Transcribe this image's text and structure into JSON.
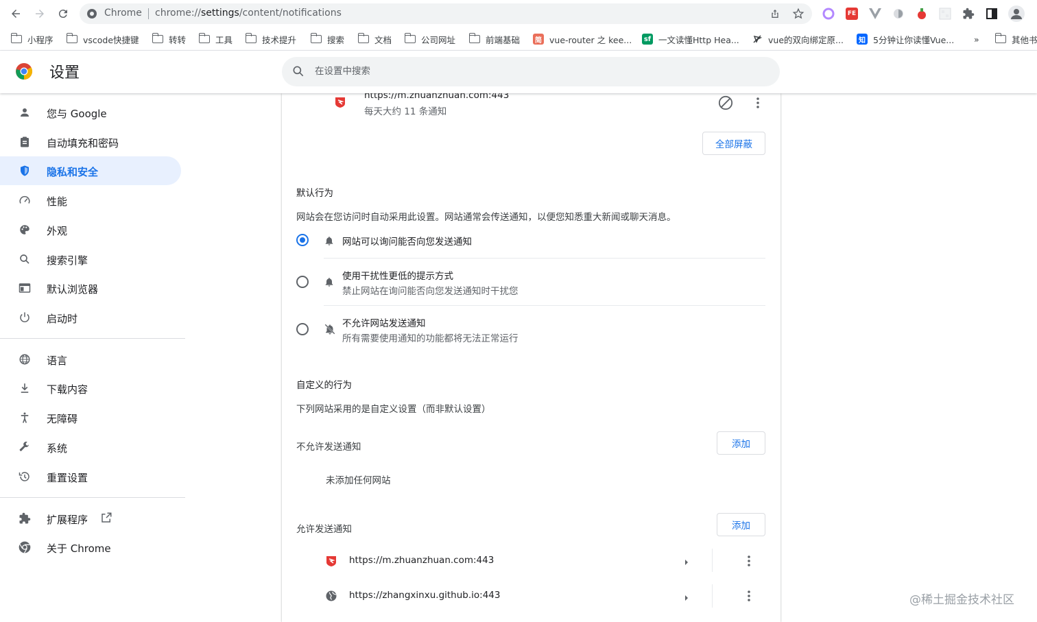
{
  "browser": {
    "omnibox_prefix": "Chrome",
    "url_scheme": "chrome://",
    "url_host": "settings",
    "url_path": "/content/notifications"
  },
  "bookmarks": [
    {
      "label": "小程序",
      "icon": "folder-icon"
    },
    {
      "label": "vscode快捷键",
      "icon": "folder-icon"
    },
    {
      "label": "转转",
      "icon": "folder-icon"
    },
    {
      "label": "工具",
      "icon": "folder-icon"
    },
    {
      "label": "技术提升",
      "icon": "folder-icon"
    },
    {
      "label": "搜索",
      "icon": "folder-icon"
    },
    {
      "label": "文档",
      "icon": "folder-icon"
    },
    {
      "label": "公司网址",
      "icon": "folder-icon"
    },
    {
      "label": "前端基础",
      "icon": "folder-icon"
    },
    {
      "label": "vue-router 之 kee...",
      "icon": "jianshu-icon",
      "badge": "简"
    },
    {
      "label": "一文读懂Http Hea...",
      "icon": "segmentfault-icon",
      "badge": "sf"
    },
    {
      "label": "vue的双向绑定原...",
      "icon": "link-icon"
    },
    {
      "label": "5分钟让你读懂Vue...",
      "icon": "zhihu-icon",
      "badge": "知"
    },
    {
      "label": "»",
      "icon": "more-icon"
    },
    {
      "label": "其他书签",
      "icon": "folder-icon"
    }
  ],
  "header": {
    "title": "设置",
    "search_placeholder": "在设置中搜索"
  },
  "sidebar": {
    "items": [
      {
        "label": "您与 Google",
        "icon": "person-icon"
      },
      {
        "label": "自动填充和密码",
        "icon": "clipboard-icon"
      },
      {
        "label": "隐私和安全",
        "icon": "shield-icon",
        "active": true
      },
      {
        "label": "性能",
        "icon": "speedometer-icon"
      },
      {
        "label": "外观",
        "icon": "palette-icon"
      },
      {
        "label": "搜索引擎",
        "icon": "search-icon"
      },
      {
        "label": "默认浏览器",
        "icon": "browser-icon"
      },
      {
        "label": "启动时",
        "icon": "power-icon"
      },
      {
        "label": "语言",
        "icon": "globe-icon"
      },
      {
        "label": "下载内容",
        "icon": "download-icon"
      },
      {
        "label": "无障碍",
        "icon": "accessibility-icon"
      },
      {
        "label": "系统",
        "icon": "wrench-icon"
      },
      {
        "label": "重置设置",
        "icon": "history-icon"
      },
      {
        "label": "扩展程序",
        "icon": "puzzle-icon"
      },
      {
        "label": "关于 Chrome",
        "icon": "chrome-icon"
      }
    ]
  },
  "main": {
    "top_site": {
      "url": "https://m.zhuanzhuan.com:443",
      "detail": "每天大约 11 条通知"
    },
    "block_all_button": "全部屏蔽",
    "default_behavior": {
      "heading": "默认行为",
      "description": "网站会在您访问时自动采用此设置。网站通常会传送通知，以便您知悉重大新闻或聊天消息。",
      "options": [
        {
          "label": "网站可以询问能否向您发送通知",
          "sublabel": "",
          "selected": true
        },
        {
          "label": "使用干扰性更低的提示方式",
          "sublabel": "禁止网站在询问能否向您发送通知时干扰您",
          "selected": false
        },
        {
          "label": "不允许网站发送通知",
          "sublabel": "所有需要使用通知的功能都将无法正常运行",
          "selected": false
        }
      ]
    },
    "custom_behavior": {
      "heading": "自定义的行为",
      "description": "下列网站采用的是自定义设置（而非默认设置）"
    },
    "blocked": {
      "heading": "不允许发送通知",
      "add_label": "添加",
      "empty_text": "未添加任何网站"
    },
    "allowed": {
      "heading": "允许发送通知",
      "add_label": "添加",
      "sites": [
        {
          "url": "https://m.zhuanzhuan.com:443",
          "icon": "zhuanzhuan-icon"
        },
        {
          "url": "https://zhangxinxu.github.io:443",
          "icon": "globe-icon"
        }
      ]
    }
  },
  "watermark": "@稀土掘金技术社区",
  "colors": {
    "accent": "#1a73e8",
    "active_bg": "#e8f0fe",
    "zhuanzhuan": "#e53935"
  }
}
